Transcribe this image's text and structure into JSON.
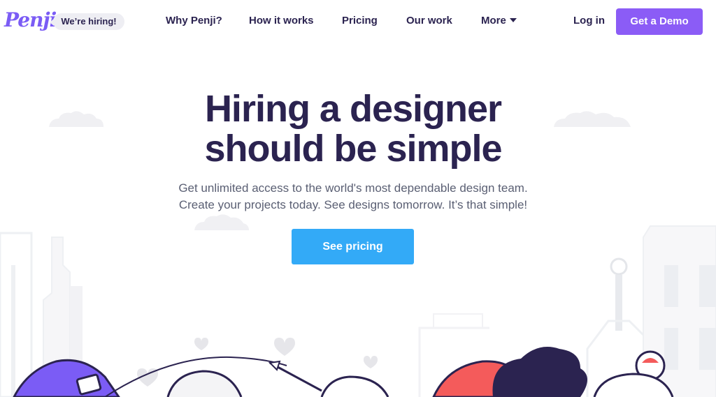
{
  "header": {
    "logo": "Penji",
    "hiring_badge": "We’re hiring!",
    "nav": {
      "why": "Why Penji?",
      "how": "How it works",
      "pricing": "Pricing",
      "work": "Our work",
      "more": "More"
    },
    "login": "Log in",
    "demo_button": "Get a Demo"
  },
  "hero": {
    "headline_line1": "Hiring a designer",
    "headline_line2": "should be simple",
    "subtext_line1": "Get unlimited access to the world's most dependable design team.",
    "subtext_line2": "Create your projects today. See designs tomorrow. It’s that simple!",
    "cta": "See pricing"
  },
  "colors": {
    "brand_purple": "#8b5cf6",
    "navy_text": "#2b2350",
    "cta_blue": "#33aaf7",
    "illustration_red": "#f45b5b"
  }
}
